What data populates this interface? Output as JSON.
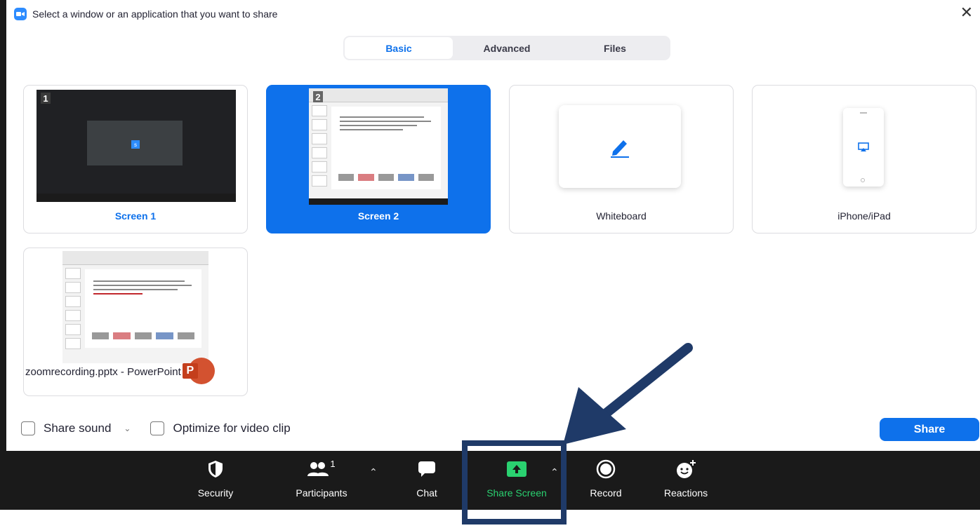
{
  "dialog": {
    "title": "Select a window or an application that you want to share",
    "close_glyph": "✕"
  },
  "tabs": [
    {
      "label": "Basic",
      "active": true
    },
    {
      "label": "Advanced",
      "active": false
    },
    {
      "label": "Files",
      "active": false
    }
  ],
  "sources": {
    "screen1": {
      "label": "Screen 1",
      "number": "1"
    },
    "screen2": {
      "label": "Screen 2",
      "number": "2",
      "selected": true
    },
    "whiteboard": {
      "label": "Whiteboard"
    },
    "iphone": {
      "label": "iPhone/iPad"
    },
    "powerpoint": {
      "label": "zoomrecording.pptx - PowerPoint",
      "badge": "P"
    }
  },
  "footer": {
    "share_sound": "Share sound",
    "optimize_video": "Optimize for video clip",
    "share_button": "Share"
  },
  "toolbar": {
    "security": "Security",
    "participants": "Participants",
    "participants_count": "1",
    "chat": "Chat",
    "share_screen": "Share Screen",
    "record": "Record",
    "reactions": "Reactions"
  },
  "colors": {
    "accent": "#0e71eb",
    "share_green": "#2ad170",
    "annotation": "#1f3a68",
    "toolbar_bg": "#1a1a1a"
  },
  "icons": [
    "zoom-logo-icon",
    "close-icon",
    "pen-icon",
    "airplay-icon",
    "powerpoint-icon",
    "shield-icon",
    "participants-icon",
    "chat-icon",
    "share-screen-icon",
    "record-icon",
    "reactions-icon",
    "chevron-up-icon",
    "chevron-down-icon"
  ]
}
